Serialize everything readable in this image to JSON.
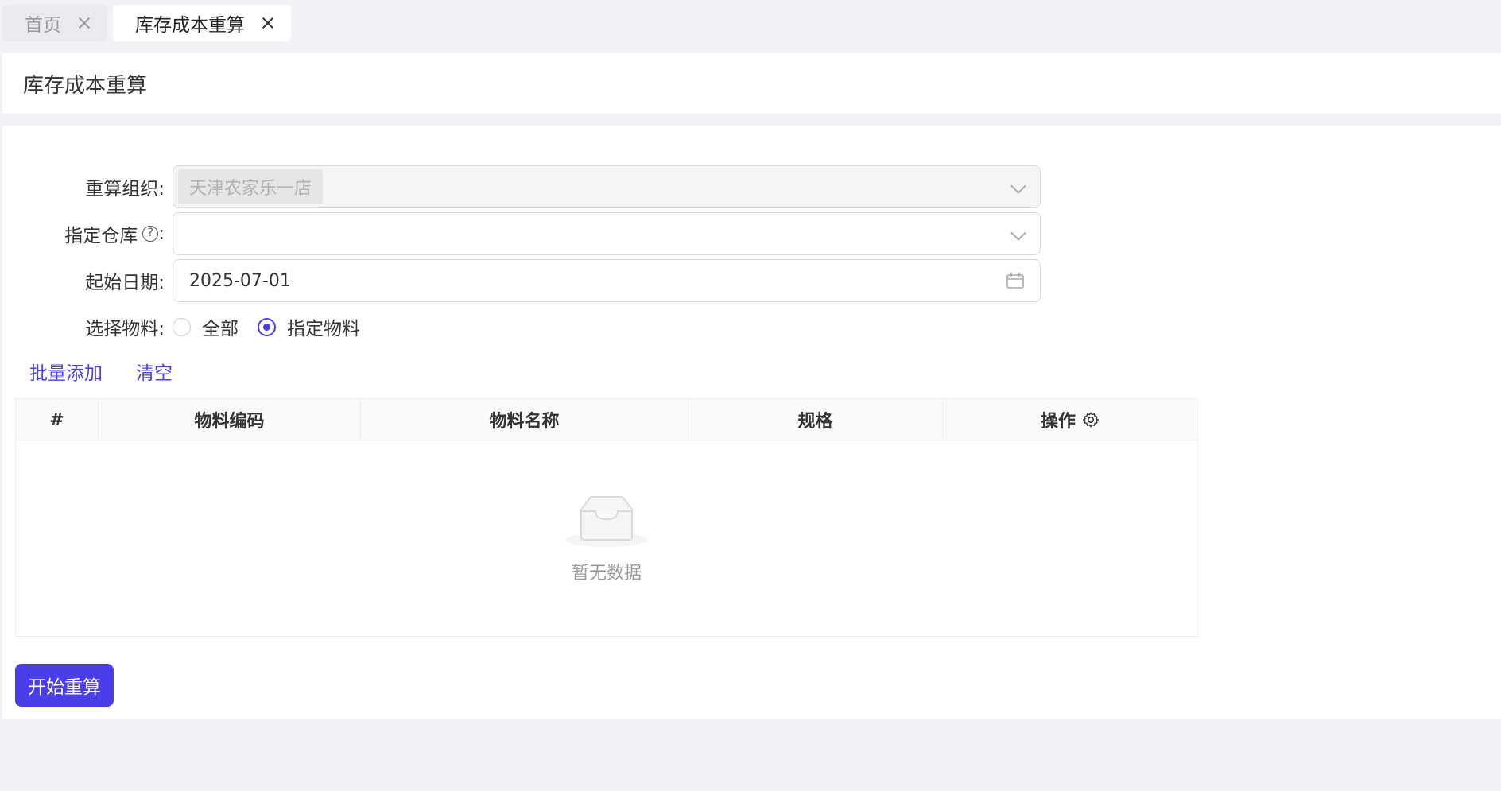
{
  "tabs": [
    {
      "label": "首页",
      "active": false
    },
    {
      "label": "库存成本重算",
      "active": true
    }
  ],
  "page_title": "库存成本重算",
  "form": {
    "org": {
      "label": "重算组织:",
      "value": "天津农家乐一店"
    },
    "warehouse": {
      "label": "指定仓库",
      "help": "?",
      "colon": ":",
      "value": ""
    },
    "start_date": {
      "label": "起始日期:",
      "value": "2025-07-01"
    },
    "material": {
      "label": "选择物料:",
      "options": [
        {
          "label": "全部",
          "checked": false
        },
        {
          "label": "指定物料",
          "checked": true
        }
      ]
    }
  },
  "actions": {
    "batch_add": "批量添加",
    "clear": "清空"
  },
  "table": {
    "columns": [
      "#",
      "物料编码",
      "物料名称",
      "规格",
      "操作"
    ],
    "empty_text": "暂无数据"
  },
  "submit_label": "开始重算",
  "colors": {
    "accent": "#4a3ee8",
    "background": "#f0f2f5"
  }
}
